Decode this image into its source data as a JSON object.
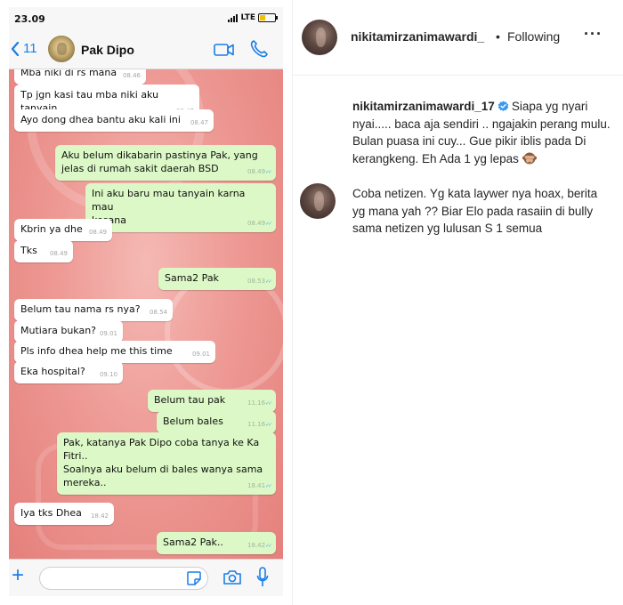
{
  "status_bar": {
    "time": "23.09",
    "network": "LTE"
  },
  "chat_header": {
    "back_count": "11",
    "contact_name": "Pak Dipo"
  },
  "messages": [
    {
      "side": "in",
      "text": "Mba niki di rs mana",
      "time": "08.46"
    },
    {
      "side": "in",
      "text": "Tp jgn kasi tau mba niki aku tanyain",
      "time": "08.47"
    },
    {
      "side": "in",
      "text": "Ayo dong dhea bantu aku kali ini",
      "time": "08.47"
    },
    {
      "side": "out",
      "text": "Aku belum dikabarin pastinya Pak, yang\njelas di rumah sakit daerah BSD",
      "time": "08.49"
    },
    {
      "side": "out",
      "text": "Ini aku baru mau tanyain karna mau\nkesana",
      "time": "08.49"
    },
    {
      "side": "in",
      "text": "Kbrin ya dhe",
      "time": "08.49"
    },
    {
      "side": "in",
      "text": "Tks",
      "time": "08.49"
    },
    {
      "side": "out",
      "text": "Sama2 Pak",
      "time": "08.53"
    },
    {
      "side": "in",
      "text": "Belum tau nama rs nya?",
      "time": "08.54"
    },
    {
      "side": "in",
      "text": "Mutiara bukan?",
      "time": "09.01"
    },
    {
      "side": "in",
      "text": "Pls info dhea help me this time",
      "time": "09.01"
    },
    {
      "side": "in",
      "text": "Eka hospital?",
      "time": "09.10"
    },
    {
      "side": "out",
      "text": "Belum tau pak",
      "time": "11.16"
    },
    {
      "side": "out",
      "text": "Belum bales",
      "time": "11.16"
    },
    {
      "side": "out",
      "text": "Pak, katanya Pak Dipo coba tanya ke Ka\nFitri..\nSoalnya aku belum di bales wanya sama\nmereka..",
      "time": "18.41"
    },
    {
      "side": "in",
      "text": "Iya tks Dhea",
      "time": "18.42"
    },
    {
      "side": "out",
      "text": "Sama2 Pak..",
      "time": "18.42"
    }
  ],
  "input_bar": {
    "placeholder": ""
  },
  "post_header": {
    "username": "nikitamirzanimawardi_",
    "separator": "•",
    "follow_status": "Following",
    "more": "···"
  },
  "caption": {
    "username": "nikitamirzanimawardi_17",
    "paragraph1": "Siapa yg nyari nyai..... baca aja sendiri .. ngajakin perang mulu. Bulan puasa ini cuy... Gue pikir iblis pada Di kerangkeng. Eh Ada 1 yg lepas",
    "paragraph2": "Coba netizen. Yg kata laywer nya hoax, berita yg mana yah ?? Biar Elo pada rasaiin di bully sama netizen yg lulusan S 1 semua"
  },
  "colors": {
    "accent_blue": "#1a7de8",
    "outgoing_bubble": "#dcf8c6",
    "incoming_bubble": "#ffffff",
    "chat_wallpaper": "#ee9a95",
    "verified_badge": "#3897f0"
  },
  "icons": [
    "back-chevron-icon",
    "video-call-icon",
    "phone-call-icon",
    "plus-icon",
    "sticker-icon",
    "camera-icon",
    "microphone-icon",
    "verified-badge-icon",
    "see-no-evil-monkey-emoji",
    "more-options-icon"
  ]
}
